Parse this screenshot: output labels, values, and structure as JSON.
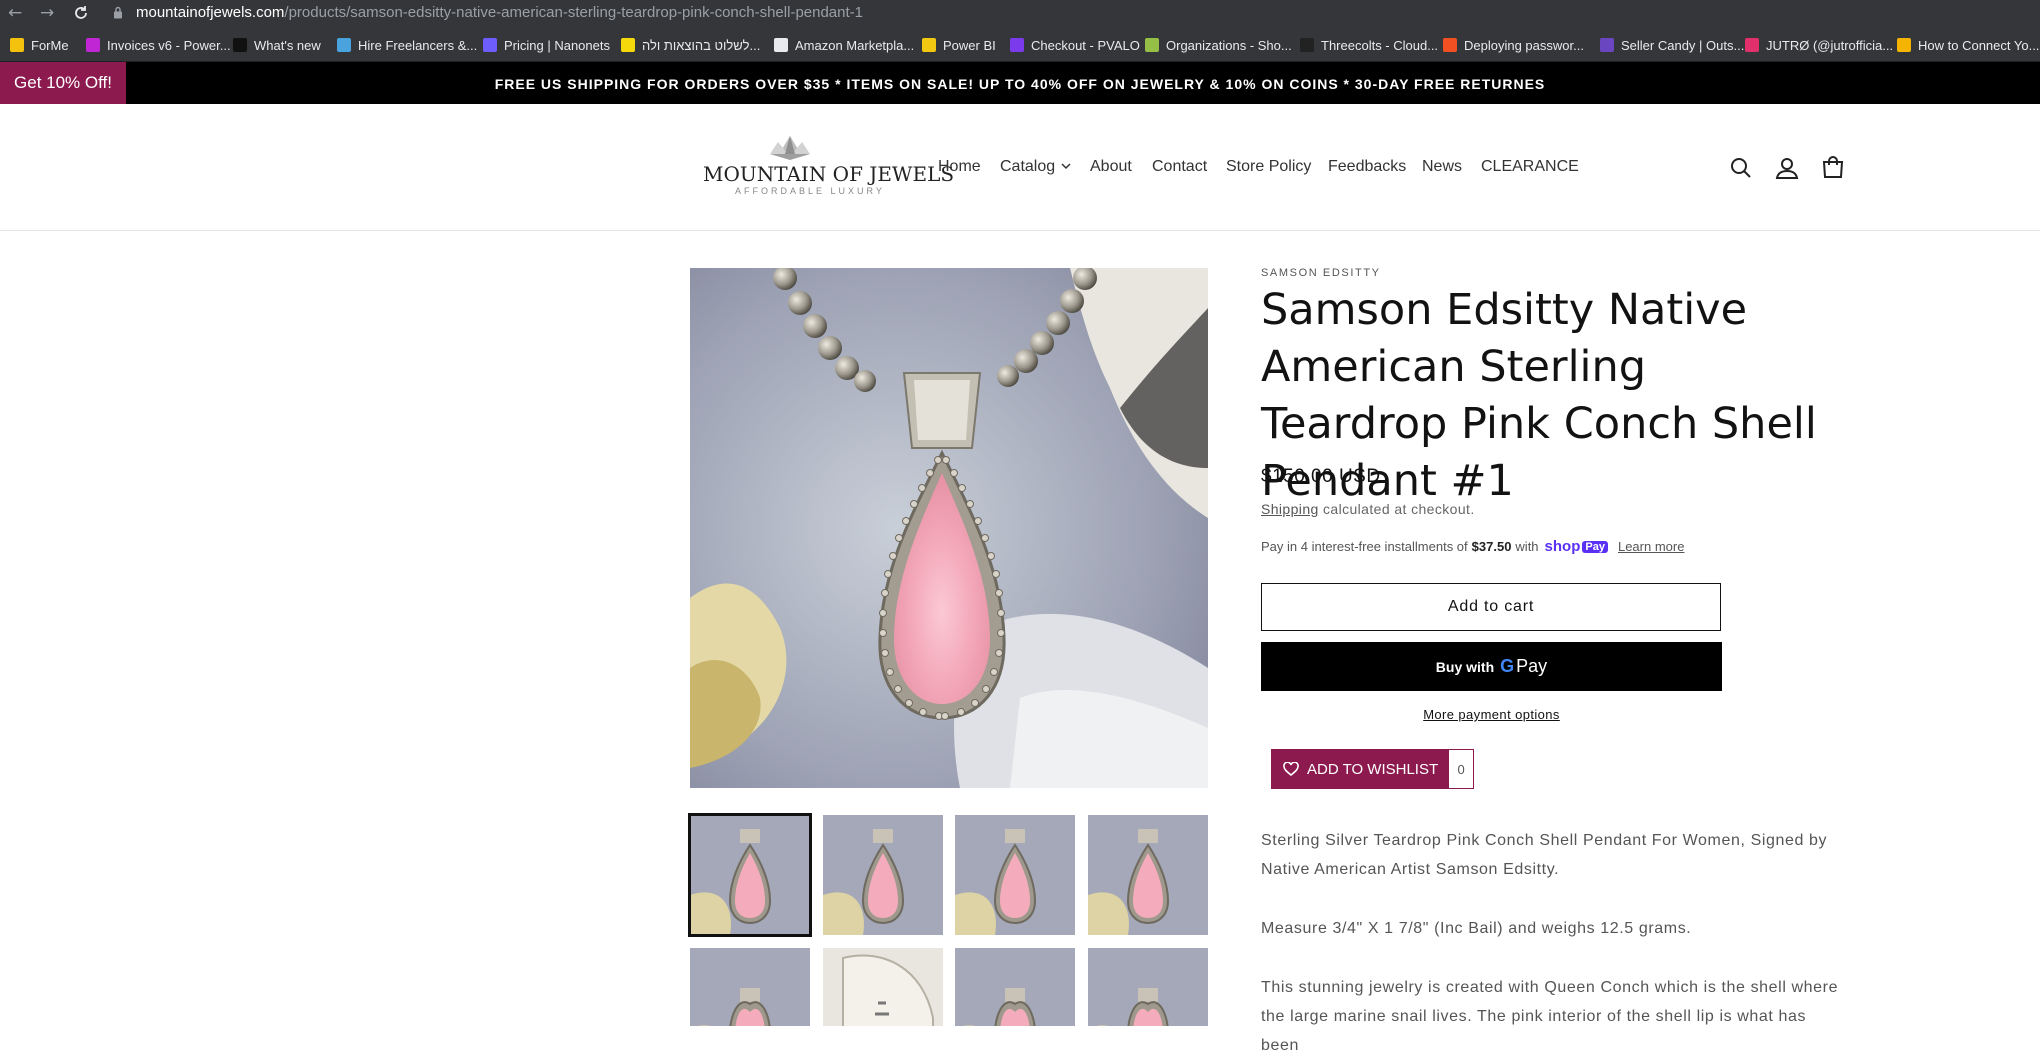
{
  "browser": {
    "url_host": "mountainofjewels.com",
    "url_path": "/products/samson-edsitty-native-american-sterling-teardrop-pink-conch-shell-pendant-1",
    "bookmarks": [
      {
        "label": "ForMe",
        "color": "#f4c20d"
      },
      {
        "label": "Invoices v6 - Power...",
        "color": "#c026d3"
      },
      {
        "label": "What's new",
        "color": "#111111"
      },
      {
        "label": "Hire Freelancers &...",
        "color": "#4aa3df"
      },
      {
        "label": "Pricing | Nanonets",
        "color": "#6d5dfc"
      },
      {
        "label": "לשלוט בהוצאות ולה...",
        "color": "#f5d90a"
      },
      {
        "label": "Amazon Marketpla...",
        "color": "#e8eaed"
      },
      {
        "label": "Power BI",
        "color": "#f2c811"
      },
      {
        "label": "Checkout - PVALO",
        "color": "#7c3aed"
      },
      {
        "label": "Organizations - Sho...",
        "color": "#95bf47"
      },
      {
        "label": "Threecolts - Cloud...",
        "color": "#222222"
      },
      {
        "label": "Deploying passwor...",
        "color": "#f25022"
      },
      {
        "label": "Seller Candy | Outs...",
        "color": "#6b46c1"
      },
      {
        "label": "JUTRØ (@jutrofficia...",
        "color": "#e1306c"
      },
      {
        "label": "How to Connect Yo...",
        "color": "#f4b400"
      }
    ]
  },
  "promo": {
    "label": "Get 10% Off!"
  },
  "announcement": {
    "text": "FREE US SHIPPING FOR ORDERS OVER $35 * ITEMS ON SALE! UP TO 40% OFF ON JEWELRY & 10% ON COINS * 30-DAY FREE RETURNES"
  },
  "header": {
    "logo_name": "MOUNTAIN OF JEWELS",
    "logo_tagline": "AFFORDABLE LUXURY",
    "nav": [
      "Home",
      "Catalog",
      "About",
      "Contact",
      "Store Policy",
      "Feedbacks",
      "News",
      "CLEARANCE"
    ],
    "icons": [
      "search-icon",
      "account-icon",
      "cart-icon"
    ]
  },
  "product": {
    "vendor": "SAMSON EDSITTY",
    "title": "Samson Edsitty Native American Sterling Teardrop Pink Conch Shell Pendant #1",
    "price": "$150.00 USD",
    "shipping_link": "Shipping",
    "shipping_note": " calculated at checkout.",
    "installments_text": "Pay in 4 interest-free installments of",
    "installment_amount": "$37.50",
    "installments_with": "with",
    "shop_label": "shop",
    "pay_label": "Pay",
    "learn_more": "Learn more",
    "add_to_cart": "Add to cart",
    "buy_with": "Buy with",
    "gpay_label": "Pay",
    "more_payment": "More payment options",
    "wishlist_label": "ADD TO WISHLIST",
    "wishlist_count": "0",
    "description": [
      "Sterling Silver Teardrop Pink Conch Shell Pendant For Women, Signed by Native American Artist Samson Edsitty.",
      "Measure 3/4\" X 1 7/8\" (Inc Bail) and weighs 12.5 grams.",
      "This stunning jewelry is created with Queen Conch which is the shell where the large marine snail lives. The pink interior of the shell lip is what has been"
    ]
  },
  "colors": {
    "brand": "#8c1a4e",
    "conch_pink": "#f2a3b3",
    "silver": "#b8b3a8"
  }
}
